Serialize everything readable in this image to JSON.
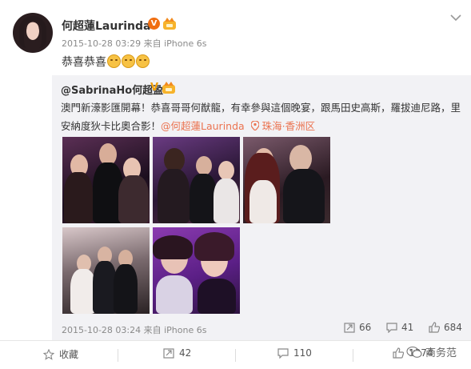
{
  "post": {
    "author": "何超蓮Laurinda",
    "verified_badge": "V",
    "meta": "2015-10-28 03:29 来自 iPhone 6s",
    "text": "恭喜恭喜",
    "emojis": [
      "blush-emoji",
      "blush-emoji",
      "blush-emoji"
    ]
  },
  "repost": {
    "author": "@SabrinaHo何超盈",
    "verified_badge": "V",
    "text_main": "澳門新濠影匯開幕！恭喜哥哥何猷龍，有幸參與這個晚宴，跟馬田史高斯，羅拔迪尼路，里安納度狄卡比奧合影！",
    "mention": "@何超蓮Laurinda",
    "location": "珠海·香洲区",
    "meta": "2015-10-28 03:24 来自 iPhone 6s",
    "stats": {
      "forward": "66",
      "comment": "41",
      "like": "684"
    },
    "photos": [
      "photo-1",
      "photo-2",
      "photo-3",
      "photo-4",
      "photo-5"
    ]
  },
  "footer": {
    "favorite": "收藏",
    "forward": "42",
    "comment": "110",
    "like": "1374"
  },
  "watermark": "商务范",
  "colors": {
    "accent": "#eb7350",
    "vip": "#f06e11",
    "repost_bg": "#f2f2f5"
  }
}
